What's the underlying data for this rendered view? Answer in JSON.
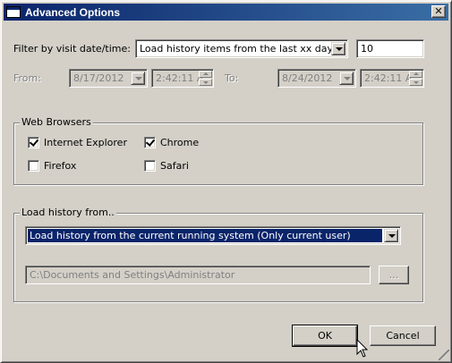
{
  "window": {
    "title": "Advanced Options",
    "close_glyph": "✕"
  },
  "filter": {
    "label": "Filter by visit date/time:",
    "selected_option": "Load history items from the last xx days",
    "days_value": "10"
  },
  "date_range": {
    "from_label": "From:",
    "from_date": "8/17/2012",
    "from_time": "2:42:11 A",
    "to_label": "To:",
    "to_date": "8/24/2012",
    "to_time": "2:42:11 A"
  },
  "browsers": {
    "group_label": "Web Browsers",
    "items": [
      {
        "label": "Internet Explorer",
        "checked": true
      },
      {
        "label": "Chrome",
        "checked": true
      },
      {
        "label": "Firefox",
        "checked": false
      },
      {
        "label": "Safari",
        "checked": false
      }
    ]
  },
  "load_from": {
    "group_label": "Load history from..",
    "selected_option": "Load history from the current running system (Only current user)",
    "path_value": "C:\\Documents and Settings\\Administrator",
    "browse_label": "..."
  },
  "footer": {
    "ok_label": "OK",
    "cancel_label": "Cancel"
  },
  "colors": {
    "titlebar_start": "#0a246a",
    "titlebar_end": "#3a6ea5",
    "selection": "#0a246a",
    "dialog_bg": "#d4d0c8"
  }
}
